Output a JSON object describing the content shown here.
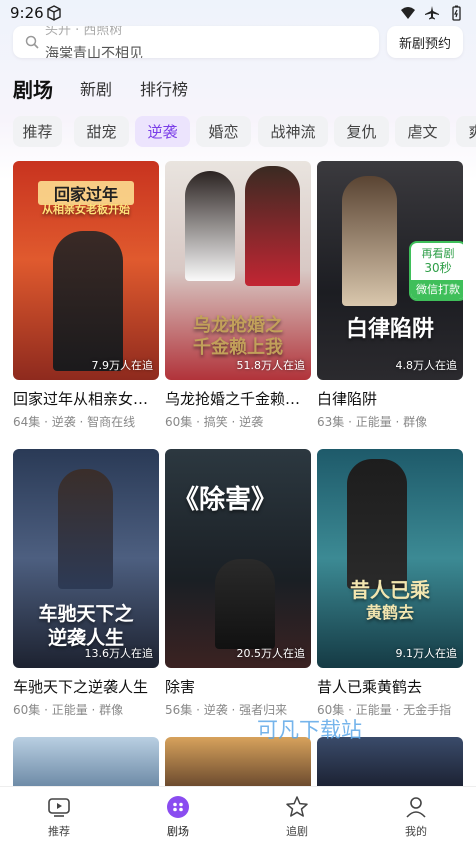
{
  "status": {
    "time": "9:26"
  },
  "search": {
    "hint": "头开 · 西照树",
    "text": "海棠青山不相见"
  },
  "header": {
    "reserve_label": "新剧预约"
  },
  "tabs": [
    "剧场",
    "新剧",
    "排行榜"
  ],
  "chips": [
    "推荐",
    "甜宠",
    "逆袭",
    "婚恋",
    "战神流",
    "复仇",
    "虐文",
    "爽"
  ],
  "badge": {
    "line1": "再看剧",
    "line2": "30秒",
    "line3": "微信打款"
  },
  "cards": [
    {
      "title": "回家过年从相亲女老板开始",
      "meta": "64集 · 逆袭 · 智商在线",
      "views": "7.9万人在追",
      "poster_text": "回家过年",
      "poster_sub": "从相亲女老板开始"
    },
    {
      "title": "乌龙抢婚之千金赖上我",
      "meta": "60集 · 搞笑 · 逆袭",
      "views": "51.8万人在追",
      "poster_text": "乌龙抢婚之",
      "poster_sub": "千金赖上我"
    },
    {
      "title": "白律陷阱",
      "meta": "63集 · 正能量 · 群像",
      "views": "4.8万人在追",
      "poster_text": "白律陷阱",
      "poster_sub": ""
    },
    {
      "title": "车驰天下之逆袭人生",
      "meta": "60集 · 正能量 · 群像",
      "views": "13.6万人在追",
      "poster_text": "车驰天下之",
      "poster_sub": "逆袭人生"
    },
    {
      "title": "除害",
      "meta": "56集 · 逆袭 · 强者归来",
      "views": "20.5万人在追",
      "poster_text": "《除害》",
      "poster_sub": ""
    },
    {
      "title": "昔人已乘黄鹤去",
      "meta": "60集 · 正能量 · 无金手指",
      "views": "9.1万人在追",
      "poster_text": "昔人已乘",
      "poster_sub": "黄鹤去"
    }
  ],
  "watermark": "可凡下载站",
  "nav": [
    "推荐",
    "剧场",
    "追剧",
    "我的"
  ]
}
